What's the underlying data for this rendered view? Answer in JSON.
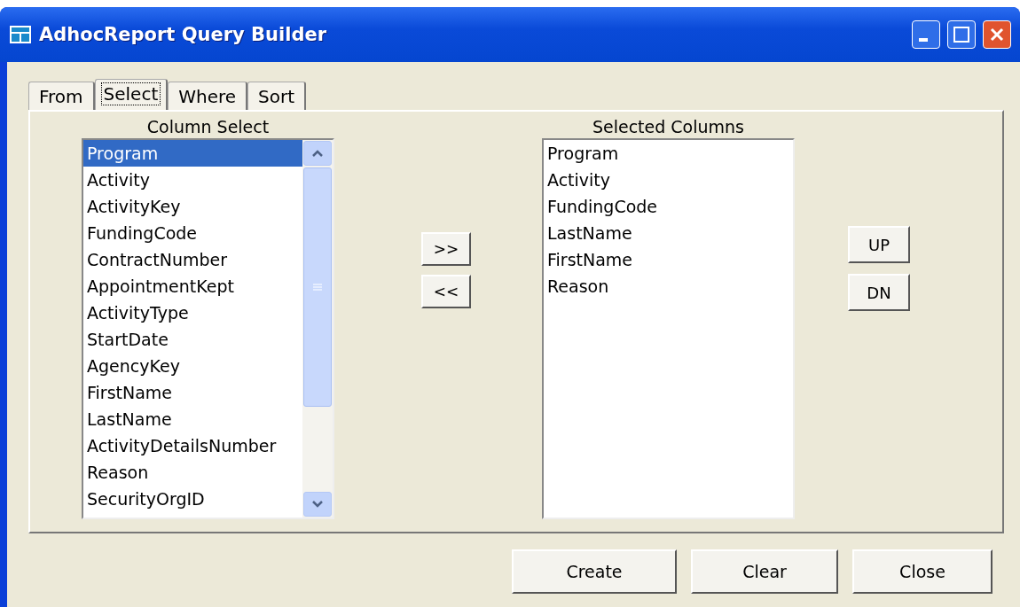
{
  "window": {
    "title": "AdhocReport Query Builder"
  },
  "tabs": [
    {
      "label": "From",
      "selected": false
    },
    {
      "label": "Select",
      "selected": true
    },
    {
      "label": "Where",
      "selected": false
    },
    {
      "label": "Sort",
      "selected": false
    }
  ],
  "column_select": {
    "label": "Column Select",
    "items": [
      {
        "label": "Program",
        "selected": true
      },
      {
        "label": "Activity",
        "selected": false
      },
      {
        "label": "ActivityKey",
        "selected": false
      },
      {
        "label": "FundingCode",
        "selected": false
      },
      {
        "label": "ContractNumber",
        "selected": false
      },
      {
        "label": "AppointmentKept",
        "selected": false
      },
      {
        "label": "ActivityType",
        "selected": false
      },
      {
        "label": "StartDate",
        "selected": false
      },
      {
        "label": "AgencyKey",
        "selected": false
      },
      {
        "label": "FirstName",
        "selected": false
      },
      {
        "label": "LastName",
        "selected": false
      },
      {
        "label": "ActivityDetailsNumber",
        "selected": false
      },
      {
        "label": "Reason",
        "selected": false
      },
      {
        "label": "SecurityOrgID",
        "selected": false
      }
    ]
  },
  "transfer_buttons": [
    ">>",
    "<<"
  ],
  "selected_columns": {
    "label": "Selected Columns",
    "items": [
      "Program",
      "Activity",
      "FundingCode",
      "LastName",
      "FirstName",
      "Reason"
    ]
  },
  "order_buttons": [
    "UP",
    "DN"
  ],
  "buttons": [
    "Create",
    "Clear",
    "Close"
  ]
}
